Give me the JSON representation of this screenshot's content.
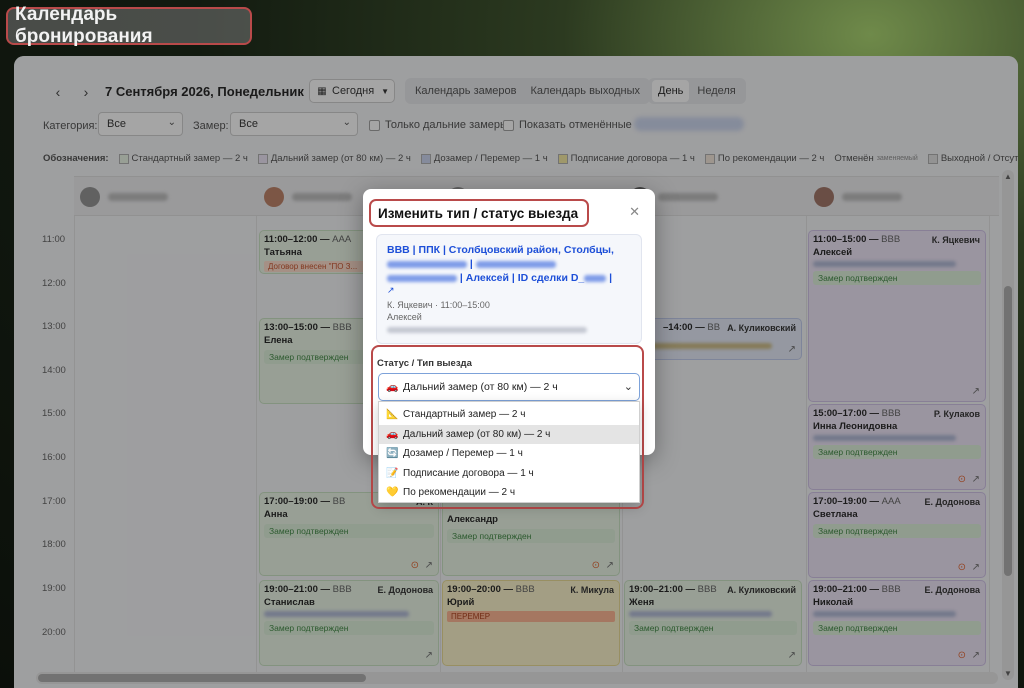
{
  "page_title": "Календарь бронирования",
  "toolbar": {
    "prev": "‹",
    "next": "›",
    "date": "7 Сентября 2026, Понедельник",
    "today": "Сегодня",
    "views": [
      "Календарь замеров",
      "Календарь выходных"
    ],
    "day": "День",
    "week": "Неделя"
  },
  "filters": {
    "category_label": "Категория:",
    "category_value": "Все",
    "measure_label": "Замер:",
    "measure_value": "Все",
    "only_far": "Только дальние замеры",
    "show_cancelled": "Показать отменённые"
  },
  "legend": {
    "title": "Обозначения:",
    "items": [
      {
        "label": "Стандартный замер — 2 ч",
        "color": "#e8f4e4"
      },
      {
        "label": "Дальний замер (от 80 км) — 2 ч",
        "color": "#ece3f6"
      },
      {
        "label": "Дозамер / Перемер — 1 ч",
        "color": "#e3e9f8"
      },
      {
        "label": "Подписание договора — 1 ч",
        "color": "#fbf3c6"
      },
      {
        "label": "По рекомендации — 2 ч",
        "color": "#f3e6d8"
      }
    ],
    "cancelled": "Отменён",
    "cancelled_sub": "заменяемый",
    "dayoff": "Выходной / Отсутствие"
  },
  "times": [
    "11:00",
    "12:00",
    "13:00",
    "14:00",
    "15:00",
    "16:00",
    "17:00",
    "18:00",
    "19:00",
    "20:00"
  ],
  "events": {
    "e1": {
      "time": "11:00–12:00",
      "type": "AAA",
      "client": "Татьяна",
      "warn": "Договор внесен \"ПО З..."
    },
    "e2": {
      "time": "13:00–15:00",
      "type": "BBB",
      "client": "Елена",
      "status": "Замер подтвержден"
    },
    "e3": {
      "time": "17:00–19:00",
      "type": "BB",
      "who": "А. К",
      "client": "Анна",
      "status": "Замер подтвержден"
    },
    "e4": {
      "time": "19:00–21:00",
      "type": "BBB",
      "who": "Е. Додонова",
      "client": "Станислав",
      "status": "Замер подтвержден"
    },
    "e5": {
      "client": "Александр",
      "status": "Замер подтвержден"
    },
    "e6": {
      "time": "19:00–20:00",
      "type": "BBB",
      "who": "К. Микула",
      "client": "Юрий",
      "perm": "ПЕРЕМЕР"
    },
    "e7": {
      "time": "–14:00",
      "type": "BB",
      "who": "А. Куликовский"
    },
    "e8": {
      "time": "19:00–21:00",
      "type": "BBB",
      "who": "А. Куликовский",
      "client": "Женя",
      "status": "Замер подтвержден"
    },
    "e9": {
      "time": "11:00–15:00",
      "type": "BBB",
      "who": "К. Яцкевич",
      "client": "Алексей",
      "status": "Замер подтвержден"
    },
    "e10": {
      "time": "15:00–17:00",
      "type": "BBB",
      "who": "Р. Кулаков",
      "client": "Инна Леонидовна",
      "status": "Замер подтвержден"
    },
    "e11": {
      "time": "17:00–19:00",
      "type": "AAA",
      "who": "Е. Додонова",
      "client": "Светлана",
      "status": "Замер подтвержден"
    },
    "e12": {
      "time": "19:00–21:00",
      "type": "BBB",
      "who": "Е. Додонова",
      "client": "Николай",
      "status": "Замер подтвержден"
    }
  },
  "modal": {
    "title": "Изменить тип / статус выезда",
    "info_a": "BBB | ППК | Столбцовский район, Столбцы,",
    "info_b": "| Алексей | ID сделки D_",
    "info_c": "|",
    "meta1": "К. Яцкевич · 11:00–15:00",
    "meta2": "Алексей",
    "status_label": "Статус / Тип выезда",
    "selected": "Дальний замер (от 80 км) — 2 ч",
    "options": [
      {
        "icon": "📐",
        "label": "Стандартный замер — 2 ч"
      },
      {
        "icon": "🚗",
        "label": "Дальний замер (от 80 км) — 2 ч"
      },
      {
        "icon": "🔄",
        "label": "Дозамер / Перемер — 1 ч"
      },
      {
        "icon": "📝",
        "label": "Подписание договора — 1 ч"
      },
      {
        "icon": "💛",
        "label": "По рекомендации — 2 ч"
      }
    ]
  }
}
